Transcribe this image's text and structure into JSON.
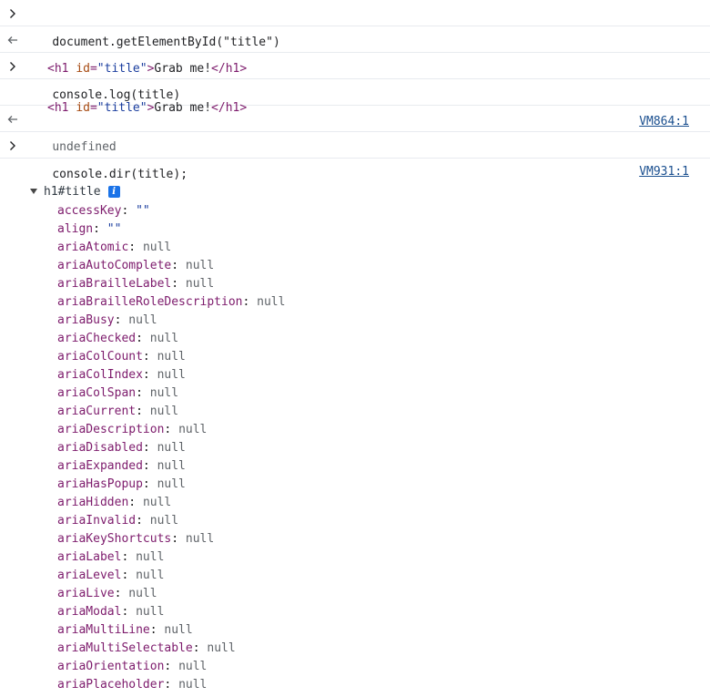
{
  "rows": {
    "cmd1": "document.getElementById(\"title\")",
    "res1": {
      "tag_open": "<h1 ",
      "attr": "id",
      "eq": "=",
      "val": "\"title\"",
      "gt": ">",
      "text": "Grab me!",
      "tag_close": "</h1>"
    },
    "cmd2": "console.log(title)",
    "log2": {
      "tag_open": "<h1 ",
      "attr": "id",
      "eq": "=",
      "val": "\"title\"",
      "gt": ">",
      "text": "Grab me!",
      "tag_close": "</h1>",
      "source": "VM864:1"
    },
    "undef": "undefined",
    "cmd3": "console.dir(title);",
    "dir": {
      "source": "VM931:1",
      "title": "h1#title",
      "info_icon": "i"
    }
  },
  "properties": [
    {
      "key": "accessKey",
      "value": "\"\"",
      "kind": "str"
    },
    {
      "key": "align",
      "value": "\"\"",
      "kind": "str"
    },
    {
      "key": "ariaAtomic",
      "value": "null",
      "kind": "null"
    },
    {
      "key": "ariaAutoComplete",
      "value": "null",
      "kind": "null"
    },
    {
      "key": "ariaBrailleLabel",
      "value": "null",
      "kind": "null"
    },
    {
      "key": "ariaBrailleRoleDescription",
      "value": "null",
      "kind": "null"
    },
    {
      "key": "ariaBusy",
      "value": "null",
      "kind": "null"
    },
    {
      "key": "ariaChecked",
      "value": "null",
      "kind": "null"
    },
    {
      "key": "ariaColCount",
      "value": "null",
      "kind": "null"
    },
    {
      "key": "ariaColIndex",
      "value": "null",
      "kind": "null"
    },
    {
      "key": "ariaColSpan",
      "value": "null",
      "kind": "null"
    },
    {
      "key": "ariaCurrent",
      "value": "null",
      "kind": "null"
    },
    {
      "key": "ariaDescription",
      "value": "null",
      "kind": "null"
    },
    {
      "key": "ariaDisabled",
      "value": "null",
      "kind": "null"
    },
    {
      "key": "ariaExpanded",
      "value": "null",
      "kind": "null"
    },
    {
      "key": "ariaHasPopup",
      "value": "null",
      "kind": "null"
    },
    {
      "key": "ariaHidden",
      "value": "null",
      "kind": "null"
    },
    {
      "key": "ariaInvalid",
      "value": "null",
      "kind": "null"
    },
    {
      "key": "ariaKeyShortcuts",
      "value": "null",
      "kind": "null"
    },
    {
      "key": "ariaLabel",
      "value": "null",
      "kind": "null"
    },
    {
      "key": "ariaLevel",
      "value": "null",
      "kind": "null"
    },
    {
      "key": "ariaLive",
      "value": "null",
      "kind": "null"
    },
    {
      "key": "ariaModal",
      "value": "null",
      "kind": "null"
    },
    {
      "key": "ariaMultiLine",
      "value": "null",
      "kind": "null"
    },
    {
      "key": "ariaMultiSelectable",
      "value": "null",
      "kind": "null"
    },
    {
      "key": "ariaOrientation",
      "value": "null",
      "kind": "null"
    },
    {
      "key": "ariaPlaceholder",
      "value": "null",
      "kind": "null"
    }
  ],
  "icons": {
    "input_prompt": "chevron-right-icon",
    "result_prompt": "return-arrow-icon",
    "expand": "triangle-down-icon",
    "info": "info-icon"
  },
  "colors": {
    "tag": "#7d1b6c",
    "attr_name": "#a64a12",
    "attr_value": "#1a3d9e",
    "link": "#1a4f8f",
    "null": "#5f6368",
    "info_badge": "#1a73e8",
    "divider": "#e8ebef"
  }
}
